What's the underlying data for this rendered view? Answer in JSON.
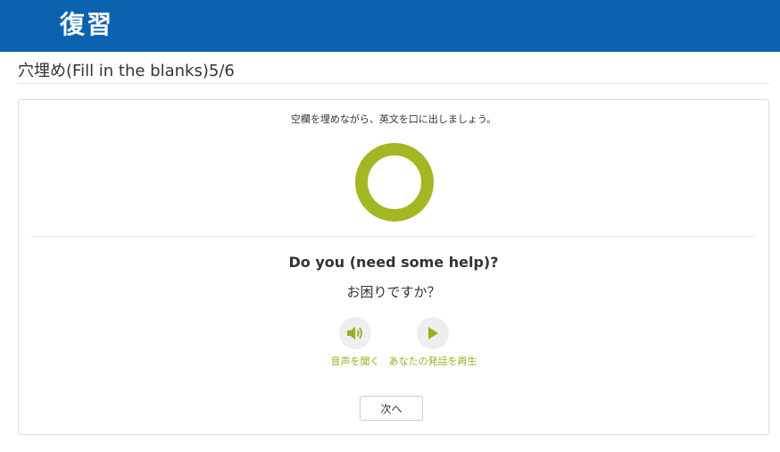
{
  "header": {
    "title": "復習"
  },
  "section": {
    "title": "穴埋め(Fill in the blanks)5/6"
  },
  "card": {
    "instruction": "空欄を埋めながら、英文を口に出しましょう。",
    "progress_ring_color": "#a3b722",
    "question": "Do you (need some help)?",
    "translation": "お困りですか？",
    "actions": [
      {
        "label": "音声を聞く",
        "icon": "speaker-icon"
      },
      {
        "label": "あなたの発話を再生",
        "icon": "play-icon"
      }
    ],
    "next_button": "次へ"
  },
  "colors": {
    "header_bg": "#0b63b0",
    "accent_green": "#95b31f",
    "icon_circle_bg": "#eeeeee"
  }
}
